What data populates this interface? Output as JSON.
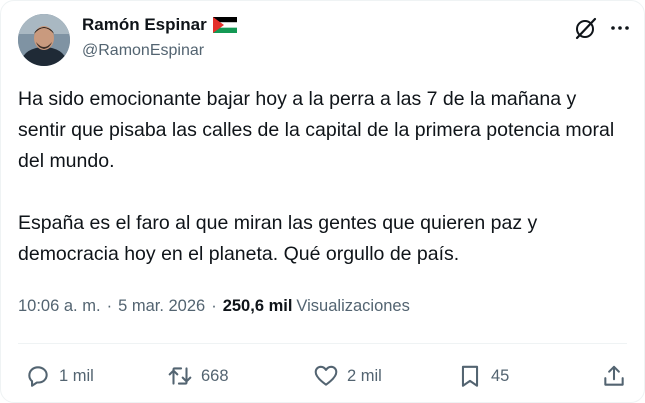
{
  "author": {
    "name": "Ramón Espinar",
    "handle": "@RamonEspinar",
    "flag_icon": "palestine-flag-icon"
  },
  "tweet": {
    "text": "Ha sido emocionante bajar hoy a la perra a las 7 de la mañana y sentir que pisaba las calles de la capital de la primera potencia moral del mundo.\n\nEspaña es el faro al que miran las gentes que quieren paz y democracia hoy en el planeta. Qué orgullo de país.",
    "time": "10:06 a. m.",
    "date": "5 mar. 2026",
    "views_count": "250,6 mil",
    "views_label": "Visualizaciones",
    "separator": "·"
  },
  "actions": {
    "replies": "1 mil",
    "retweets": "668",
    "likes": "2 mil",
    "bookmarks": "45"
  },
  "colors": {
    "text": "#0f1419",
    "secondary": "#536471",
    "border": "#eff3f4"
  }
}
